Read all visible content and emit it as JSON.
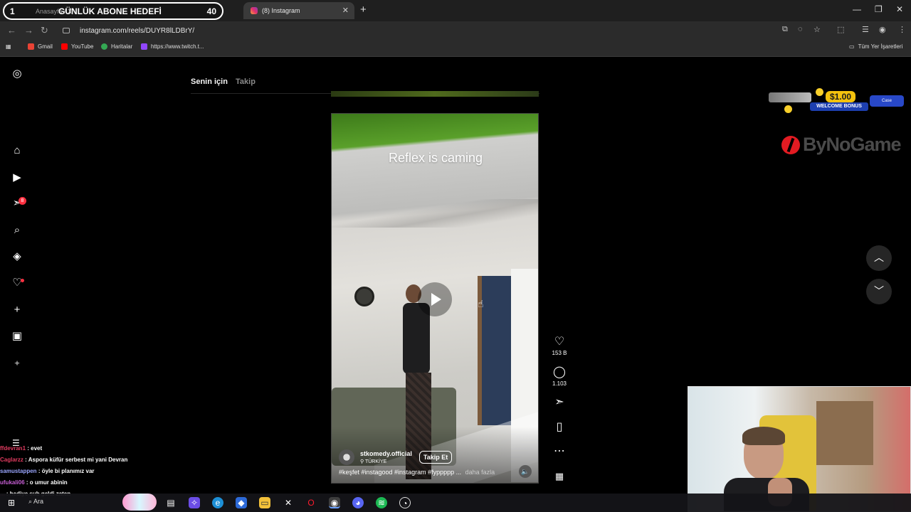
{
  "browser": {
    "tabs": [
      {
        "title": "Anasayfa / X",
        "active": false
      },
      {
        "title": "(8) Instagram",
        "active": true
      }
    ],
    "url": "instagram.com/reels/DUYR8lLDBrY/",
    "bookmarks": [
      "Gmail",
      "YouTube",
      "Haritalar",
      "https://www.twitch.t..."
    ],
    "all_bookmarks_label": "Tüm Yer İşaretleri"
  },
  "stream_goal": {
    "index": "1",
    "label": "GÜNLÜK ABONE HEDEFİ",
    "count": "40"
  },
  "instagram": {
    "feed_tabs": [
      "Senin için",
      "Takip"
    ],
    "notifications_count": "8",
    "reel": {
      "overlay_text": "Reflex is caming",
      "author": "stkomedy.official",
      "location": "TÜRKİYE",
      "follow_label": "Takip Et",
      "hashtags": "#keşfet #instagood #instagram #fyppppp ...",
      "more_label": "daha fazla"
    },
    "actions": {
      "likes": "153 B",
      "comments": "1.103"
    }
  },
  "sponsor": {
    "price": "$1.00",
    "bonus": "WELCOME BONUS",
    "case": "Case",
    "brand": "ByNoGame"
  },
  "chat": [
    {
      "user": "ffdevran1",
      "text": ": evet"
    },
    {
      "user": "Caglarzz",
      "text": ": Aspora küfür serbest mi yani Devran"
    },
    {
      "user": "samustappen",
      "text": ": öyle bi planımız var"
    },
    {
      "user": "ufukali06",
      "text": ": o umur abinin"
    },
    {
      "user": "...",
      "text": ": hediye sub geldi zaten"
    }
  ],
  "taskbar": {
    "search_label": "Ara"
  }
}
